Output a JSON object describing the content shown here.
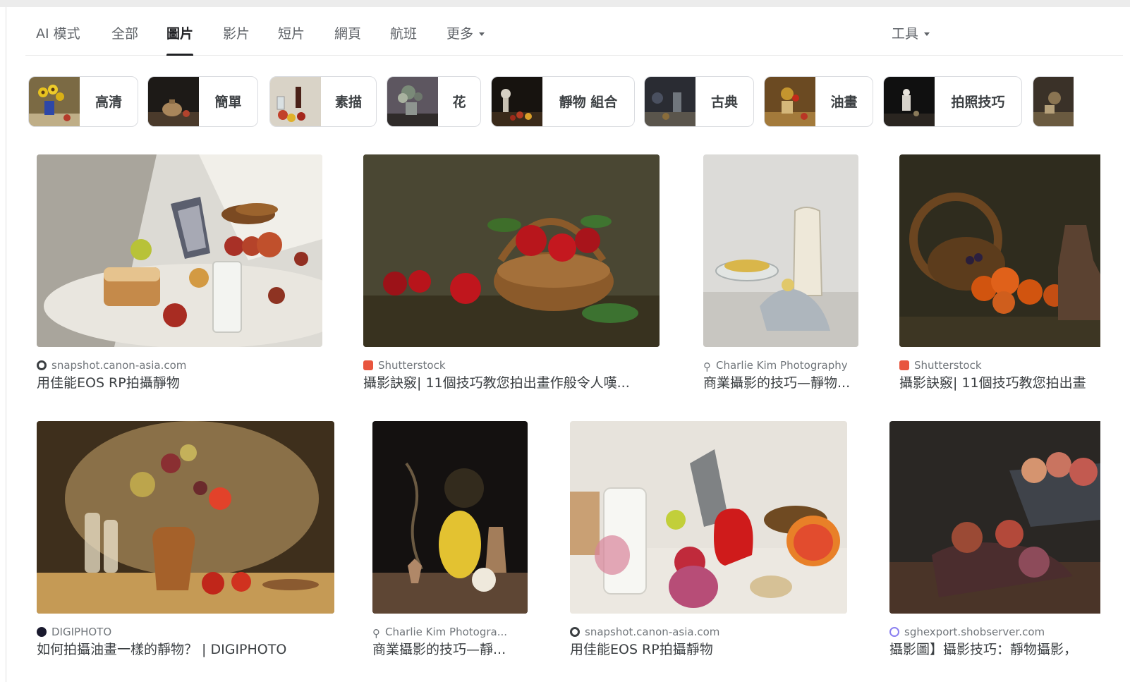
{
  "nav": {
    "tabs": [
      {
        "label": "AI 模式"
      },
      {
        "label": "全部"
      },
      {
        "label": "圖片"
      },
      {
        "label": "影片"
      },
      {
        "label": "短片"
      },
      {
        "label": "網頁"
      },
      {
        "label": "航班"
      },
      {
        "label": "更多"
      }
    ],
    "tools_label": "工具"
  },
  "chips": [
    {
      "label": "高清"
    },
    {
      "label": "簡單"
    },
    {
      "label": "素描"
    },
    {
      "label": "花"
    },
    {
      "label": "靜物 組合"
    },
    {
      "label": "古典"
    },
    {
      "label": "油畫"
    },
    {
      "label": "拍照技巧"
    }
  ],
  "results": [
    {
      "source": "snapshot.canon-asia.com",
      "title": "用佳能EOS RP拍攝靜物"
    },
    {
      "source": "Shutterstock",
      "title": "攝影訣竅| 11個技巧教您拍出畫作般令人嘆..."
    },
    {
      "source": "Charlie Kim Photography",
      "title": "商業攝影的技巧—靜物..."
    },
    {
      "source": "Shutterstock",
      "title": "攝影訣竅| 11個技巧教您拍出畫"
    },
    {
      "source": "DIGIPHOTO",
      "title": "如何拍攝油畫一樣的靜物？ | DIGIPHOTO"
    },
    {
      "source": "Charlie Kim Photogra...",
      "title": "商業攝影的技巧—靜..."
    },
    {
      "source": "snapshot.canon-asia.com",
      "title": "用佳能EOS RP拍攝靜物"
    },
    {
      "source": "sghexport.shobserver.com",
      "title": "攝影圖】攝影技巧：靜物攝影，"
    }
  ]
}
